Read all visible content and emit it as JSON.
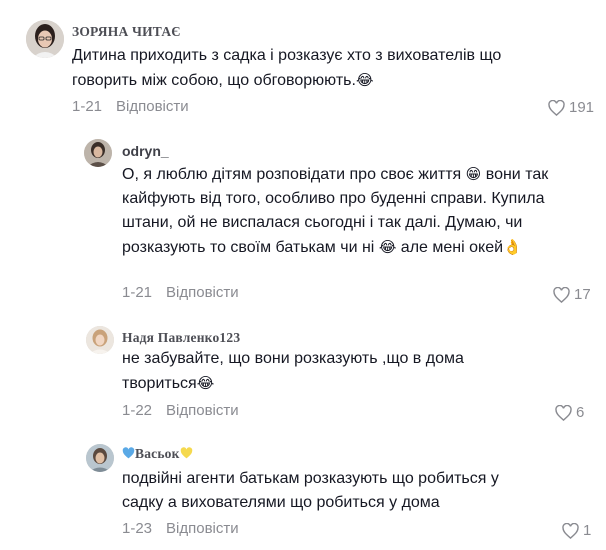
{
  "comments": [
    {
      "username": "ЗОРЯНА ЧИТАЄ",
      "text": "Дитина приходить з садка і розказує хто з вихователів що говорить між собою, що обговорюють.",
      "emoji": "😂",
      "date": "1-21",
      "reply_label": "Відповісти",
      "likes": "191"
    },
    {
      "username": "odryn_",
      "text_part1": "О, я люблю дітям розповідати про своє життя",
      "emoji1": "😁",
      "text_part2": "вони так кайфують від того, особливо про буденні справи. Купила штани, ой не виспалася сьогодні і так далі. Думаю, чи розказують то своїм батькам чи ні",
      "emoji2": "😂",
      "text_part3": "але мені окей",
      "emoji3": "👌",
      "date": "1-21",
      "reply_label": "Відповісти",
      "likes": "17"
    },
    {
      "username": "Надя Павленко123",
      "text": "не забувайте, що вони розказують ,що в дома твориться",
      "emoji": "😂",
      "date": "1-22",
      "reply_label": "Відповісти",
      "likes": "6"
    },
    {
      "username_prefix_icon": "blue-heart-icon",
      "username": "Васьок",
      "username_suffix_icon": "yellow-heart-icon",
      "text": "подвійні агенти батькам розказують що робиться у садку а вихователями що робиться у дома",
      "date": "1-23",
      "reply_label": "Відповісти",
      "likes": "1"
    }
  ],
  "colors": {
    "text": "#161823",
    "meta": "#8a8b91",
    "username": "#4d4e55",
    "blue_heart": "#5aa9e6",
    "yellow_heart": "#f5d94e"
  }
}
